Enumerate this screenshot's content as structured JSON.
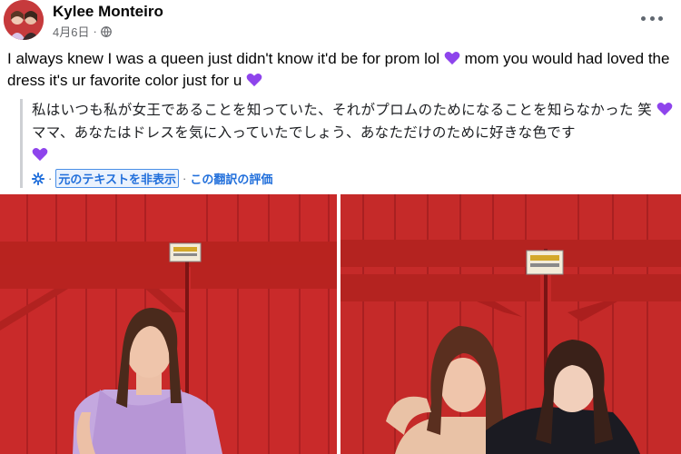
{
  "post": {
    "author": "Kylee Monteiro",
    "date": "4月6日",
    "privacy_icon": "globe-icon",
    "text_part1": "I always knew I was a queen just didn't know it'd be for prom lol",
    "text_part2": " mom you would had loved the dress it's ur favorite color just for u",
    "emoji": "purple-heart"
  },
  "translation": {
    "text_part1": "私はいつも私が女王であることを知っていた、それがプロムのためになることを知らなかった 笑",
    "text_part2": "ママ、あなたはドレスを気に入っていたでしょう、あなただけのために好きな色です",
    "hide_original_label": "元のテキストを非表示",
    "rate_label": "この翻訳の評価",
    "separator": "·"
  },
  "photos": [
    {
      "subject": "girl in lavender dress in front of red barn door"
    },
    {
      "subject": "two women hugging in front of red barn door"
    }
  ],
  "colors": {
    "link": "#216fdb",
    "barn_red": "#c92a2a",
    "heart": "#8e44ec"
  }
}
